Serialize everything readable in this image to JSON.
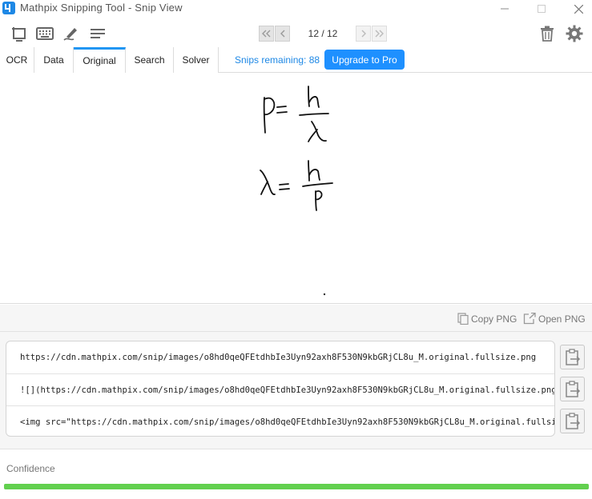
{
  "window": {
    "title": "Mathpix Snipping Tool - Snip View"
  },
  "toolbar": {
    "icons": [
      "crop-screen-icon",
      "keyboard-icon",
      "pen-icon",
      "menu-lines-icon"
    ],
    "counter": "12 / 12",
    "right_icons": [
      "trash-icon",
      "gear-icon"
    ]
  },
  "tabs": [
    {
      "label": "OCR",
      "active": false
    },
    {
      "label": "Data",
      "active": false
    },
    {
      "label": "Original",
      "active": true
    },
    {
      "label": "Search",
      "active": false
    },
    {
      "label": "Solver",
      "active": false
    }
  ],
  "account": {
    "snips_remaining": "Snips remaining: 88",
    "upgrade_label": "Upgrade to Pro"
  },
  "png_actions": {
    "copy_label": "Copy PNG",
    "open_label": "Open PNG"
  },
  "links": [
    "https://cdn.mathpix.com/snip/images/o8hd0qeQFEtdhbIe3Uyn92axh8F530N9kbGRjCL8u_M.original.fullsize.png",
    "![](https://cdn.mathpix.com/snip/images/o8hd0qeQFEtdhbIe3Uyn92axh8F530N9kbGRjCL8u_M.original.fullsize.png)",
    "<img src=\"https://cdn.mathpix.com/snip/images/o8hd0qeQFEtdhbIe3Uyn92axh8F530N9kbGRjCL8u_M.original.fullsize.png\" />"
  ],
  "confidence": {
    "label": "Confidence",
    "value": 1.0,
    "color": "#62d04f"
  },
  "colors": {
    "accent": "#1e90ff",
    "tab_active": "#2196f3"
  }
}
